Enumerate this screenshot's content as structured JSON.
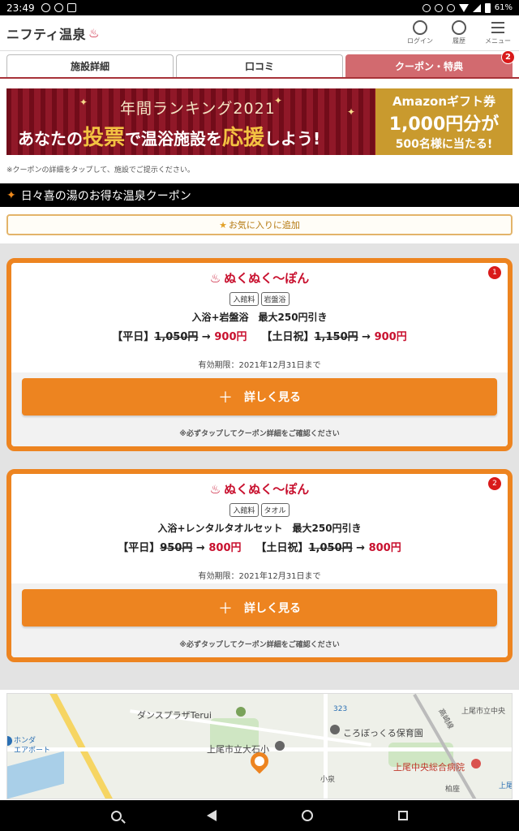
{
  "status_bar": {
    "time": "23:49",
    "battery": "61%"
  },
  "header": {
    "logo": "ニフティ温泉",
    "actions": [
      {
        "label": "ログイン"
      },
      {
        "label": "履歴"
      },
      {
        "label": "メニュー"
      }
    ]
  },
  "tabs": [
    {
      "label": "施設詳細"
    },
    {
      "label": "口コミ"
    },
    {
      "label": "クーポン・特典",
      "badge": "2"
    }
  ],
  "banner": {
    "title": "年間ランキング2021",
    "main_pre": "あなたの",
    "main_vote": "投票",
    "main_mid": "で温浴施設を",
    "main_support": "応援",
    "main_post": "しよう!",
    "right_line1": "Amazonギフト券",
    "right_line2": "1,000円分が",
    "right_line3": "500名様に当たる!"
  },
  "note": "※クーポンの詳細をタップして、施設でご提示ください。",
  "section_title": "日々喜の湯のお得な温泉クーポン",
  "favorite_button": "お気に入りに追加",
  "coupons": [
    {
      "number": "1",
      "name": "ぬくぬく～ぽん",
      "tags": [
        "入館料",
        "岩盤浴"
      ],
      "description": "入浴+岩盤浴　最大250円引き",
      "weekday_label": "【平日】",
      "weekday_old": "1,050円",
      "weekday_new": "900円",
      "holiday_label": "【土日祝】",
      "holiday_old": "1,150円",
      "holiday_new": "900円",
      "expire": "有効期限：2021年12月31日まで",
      "button": "詳しく見る",
      "caution": "※必ずタップしてクーポン詳細をご確認ください"
    },
    {
      "number": "2",
      "name": "ぬくぬく～ぽん",
      "tags": [
        "入館料",
        "タオル"
      ],
      "description": "入浴+レンタルタオルセット　最大250円引き",
      "weekday_label": "【平日】",
      "weekday_old": "950円",
      "weekday_new": "800円",
      "holiday_label": "【土日祝】",
      "holiday_old": "1,050円",
      "holiday_new": "800円",
      "expire": "有効期限：2021年12月31日まで",
      "button": "詳しく見る",
      "caution": "※必ずタップしてクーポン詳細をご確認ください"
    }
  ],
  "map": {
    "labels": {
      "dance": "ダンスプラザTerui",
      "honda": "ホンダ",
      "honda2": "エアポート",
      "school": "上尾市立大石小",
      "nursery": "ころぼっくる保育園",
      "hospital": "上尾中央総合病院",
      "city": "上尾市立中央",
      "kashiwaza": "柏座",
      "koizumi": "小泉",
      "route": "323",
      "takasaki": "高崎線",
      "ageo": "上尾"
    }
  },
  "accent_color": "#ed8420",
  "brand_red": "#c8102e"
}
